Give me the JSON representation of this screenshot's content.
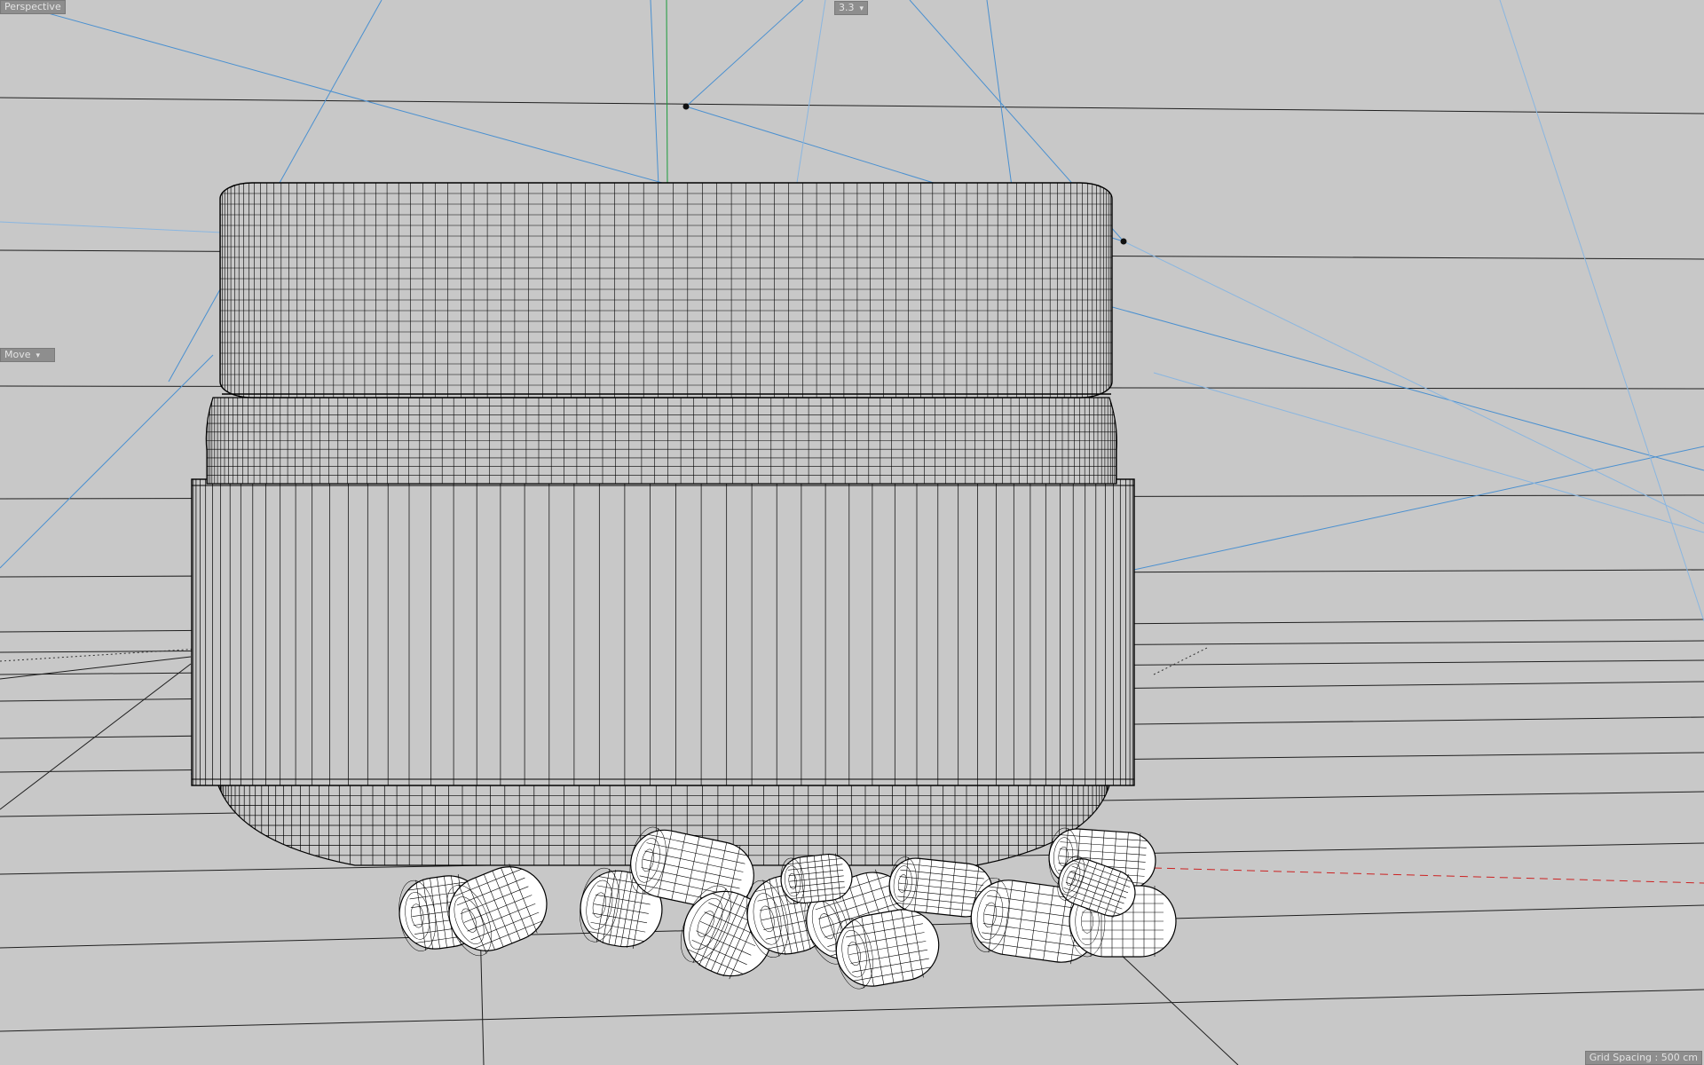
{
  "viewport": {
    "view_name": "Perspective",
    "camera_name": "3.3",
    "camera_dropdown_glyph": "▾",
    "active_tool": "Move",
    "active_tool_glyph": "▾",
    "grid_spacing": "Grid Spacing : 500 cm",
    "background_color": "#c8c8c8",
    "wire_color": "#000000",
    "guide_color": "#4a90d0",
    "axis_x_color": "#cc2222",
    "axis_y_color": "#1a9a3a"
  },
  "scene": {
    "objects": [
      "jar-lid-icon",
      "jar-neck-icon",
      "jar-body-icon",
      "jar-base-icon",
      "capsule-icon"
    ]
  }
}
